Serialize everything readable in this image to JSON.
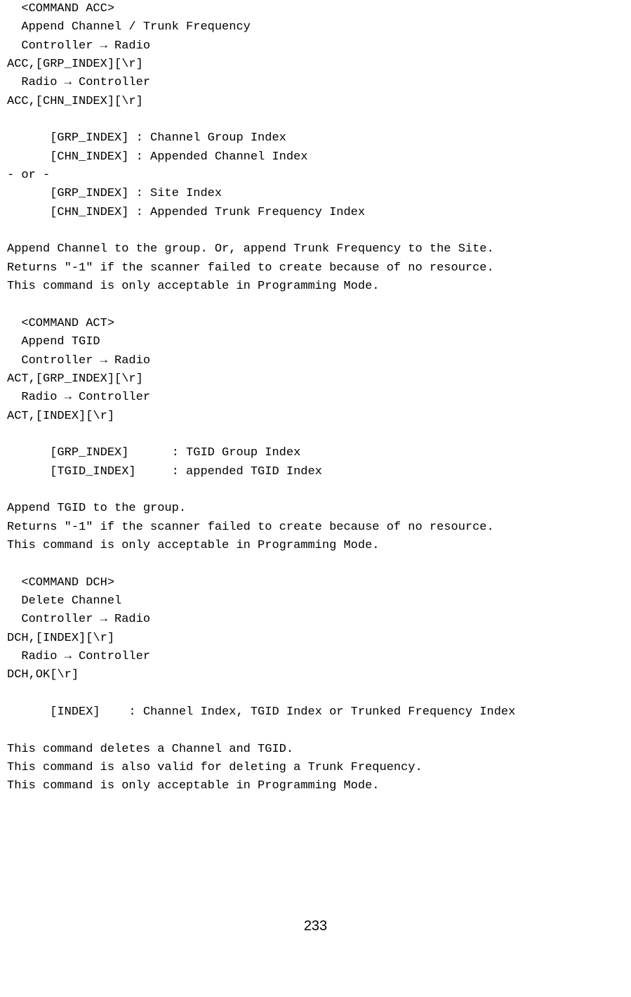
{
  "acc": {
    "header": "  <COMMAND ACC>",
    "title": "  Append Channel / Trunk Frequency",
    "c2r_label": "  Controller → Radio",
    "c2r_cmd": "ACC,[GRP_INDEX][\\r]",
    "r2c_label": "  Radio → Controller",
    "r2c_cmd": "ACC,[CHN_INDEX][\\r]",
    "p1": "      [GRP_INDEX] : Channel Group Index",
    "p2": "      [CHN_INDEX] : Appended Channel Index",
    "or": "- or -",
    "p3": "      [GRP_INDEX] : Site Index",
    "p4": "      [CHN_INDEX] : Appended Trunk Frequency Index",
    "d1": "Append Channel to the group. Or, append Trunk Frequency to the Site.",
    "d2": "Returns \"-1\" if the scanner failed to create because of no resource.",
    "d3": "This command is only acceptable in Programming Mode."
  },
  "act": {
    "header": "  <COMMAND ACT>",
    "title": "  Append TGID",
    "c2r_label": "  Controller → Radio",
    "c2r_cmd": "ACT,[GRP_INDEX][\\r]",
    "r2c_label": "  Radio → Controller",
    "r2c_cmd": "ACT,[INDEX][\\r]",
    "p1": "      [GRP_INDEX]      : TGID Group Index",
    "p2": "      [TGID_INDEX]     : appended TGID Index",
    "d1": "Append TGID to the group.",
    "d2": "Returns \"-1\" if the scanner failed to create because of no resource.",
    "d3": "This command is only acceptable in Programming Mode."
  },
  "dch": {
    "header": "  <COMMAND DCH>",
    "title": "  Delete Channel",
    "c2r_label": "  Controller → Radio",
    "c2r_cmd": "DCH,[INDEX][\\r]",
    "r2c_label": "  Radio → Controller",
    "r2c_cmd": "DCH,OK[\\r]",
    "p1": "      [INDEX]    : Channel Index, TGID Index or Trunked Frequency Index",
    "d1": "This command deletes a Channel and TGID.",
    "d2": "This command is also valid for deleting a Trunk Frequency.",
    "d3": "This command is only acceptable in Programming Mode."
  },
  "page_number": "233"
}
